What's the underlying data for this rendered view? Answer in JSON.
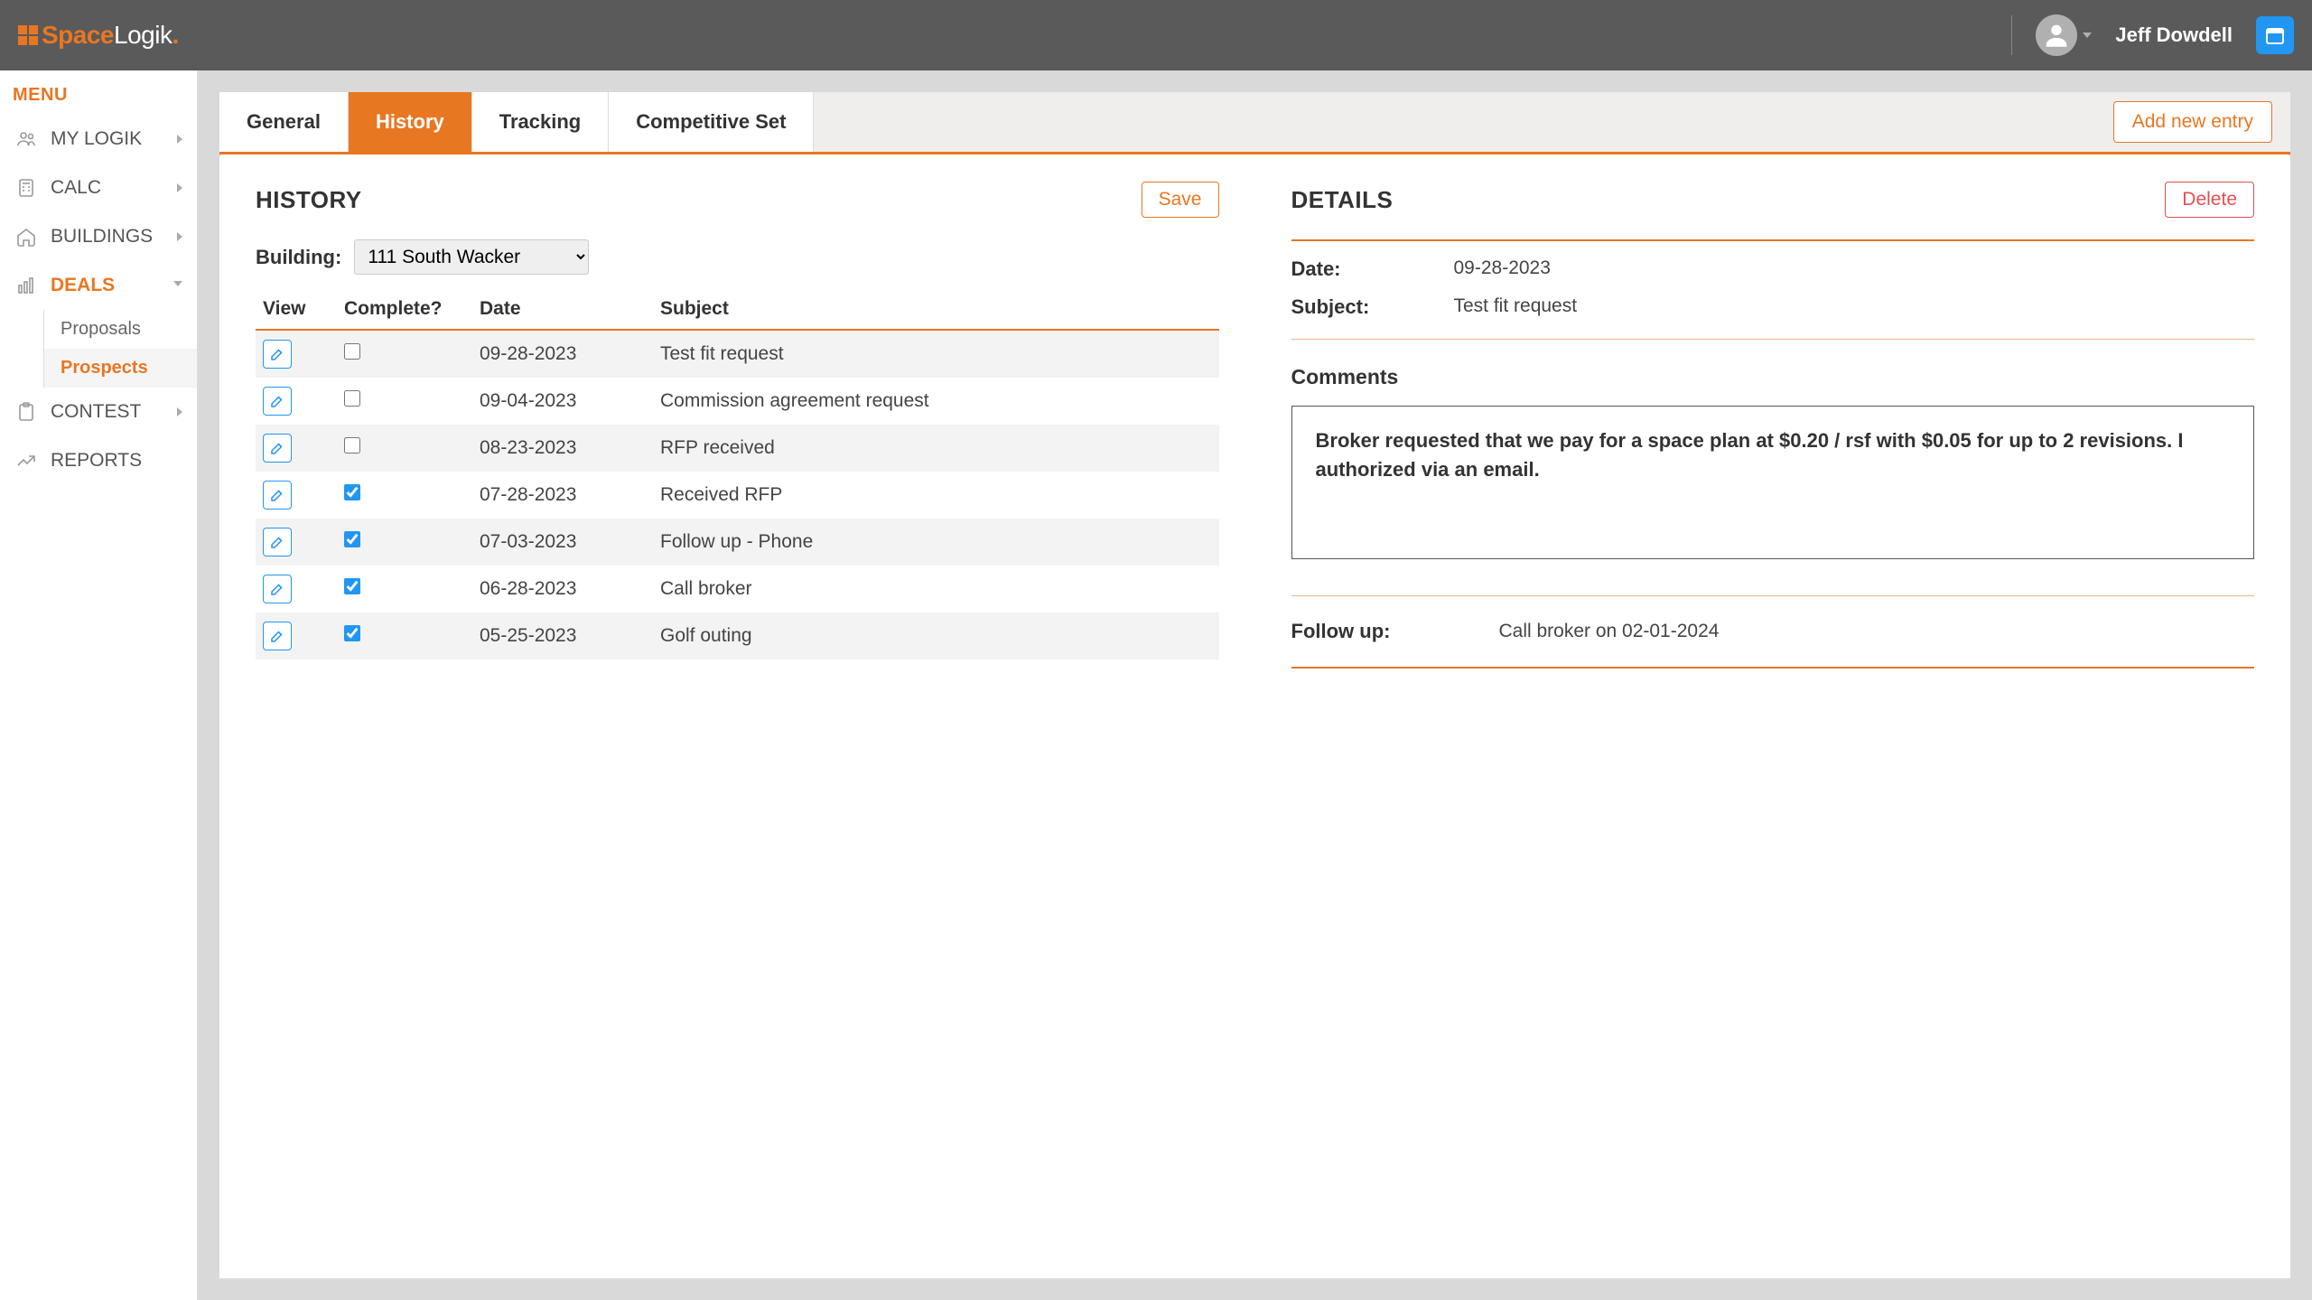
{
  "header": {
    "brand_a": "Space",
    "brand_b": "Logik",
    "username": "Jeff Dowdell"
  },
  "sidebar": {
    "menu_label": "MENU",
    "items": [
      {
        "label": "MY LOGIK",
        "expandable": true
      },
      {
        "label": "CALC",
        "expandable": true
      },
      {
        "label": "BUILDINGS",
        "expandable": true
      },
      {
        "label": "DEALS",
        "expandable": true,
        "active": true,
        "sub": [
          {
            "label": "Proposals"
          },
          {
            "label": "Prospects",
            "active": true
          }
        ]
      },
      {
        "label": "CONTEST",
        "expandable": true
      },
      {
        "label": "REPORTS"
      }
    ]
  },
  "tabs": {
    "items": [
      "General",
      "History",
      "Tracking",
      "Competitive Set"
    ],
    "active": "History",
    "add_entry": "Add new entry"
  },
  "history": {
    "title": "HISTORY",
    "save": "Save",
    "building_label": "Building:",
    "building_value": "111 South Wacker",
    "columns": [
      "View",
      "Complete?",
      "Date",
      "Subject"
    ],
    "rows": [
      {
        "complete": false,
        "date": "09-28-2023",
        "subject": "Test fit request"
      },
      {
        "complete": false,
        "date": "09-04-2023",
        "subject": "Commission agreement request"
      },
      {
        "complete": false,
        "date": "08-23-2023",
        "subject": "RFP received"
      },
      {
        "complete": true,
        "date": "07-28-2023",
        "subject": "Received RFP"
      },
      {
        "complete": true,
        "date": "07-03-2023",
        "subject": "Follow up - Phone"
      },
      {
        "complete": true,
        "date": "06-28-2023",
        "subject": "Call broker"
      },
      {
        "complete": true,
        "date": "05-25-2023",
        "subject": "Golf outing"
      }
    ]
  },
  "details": {
    "title": "DETAILS",
    "delete": "Delete",
    "date_label": "Date:",
    "date_value": "09-28-2023",
    "subject_label": "Subject:",
    "subject_value": "Test fit request",
    "comments_label": "Comments",
    "comments_text": "Broker requested that we pay for a space plan at $0.20 / rsf with $0.05 for up to 2 revisions. I authorized via an email.",
    "followup_label": "Follow up:",
    "followup_value": "Call broker on 02-01-2024"
  }
}
